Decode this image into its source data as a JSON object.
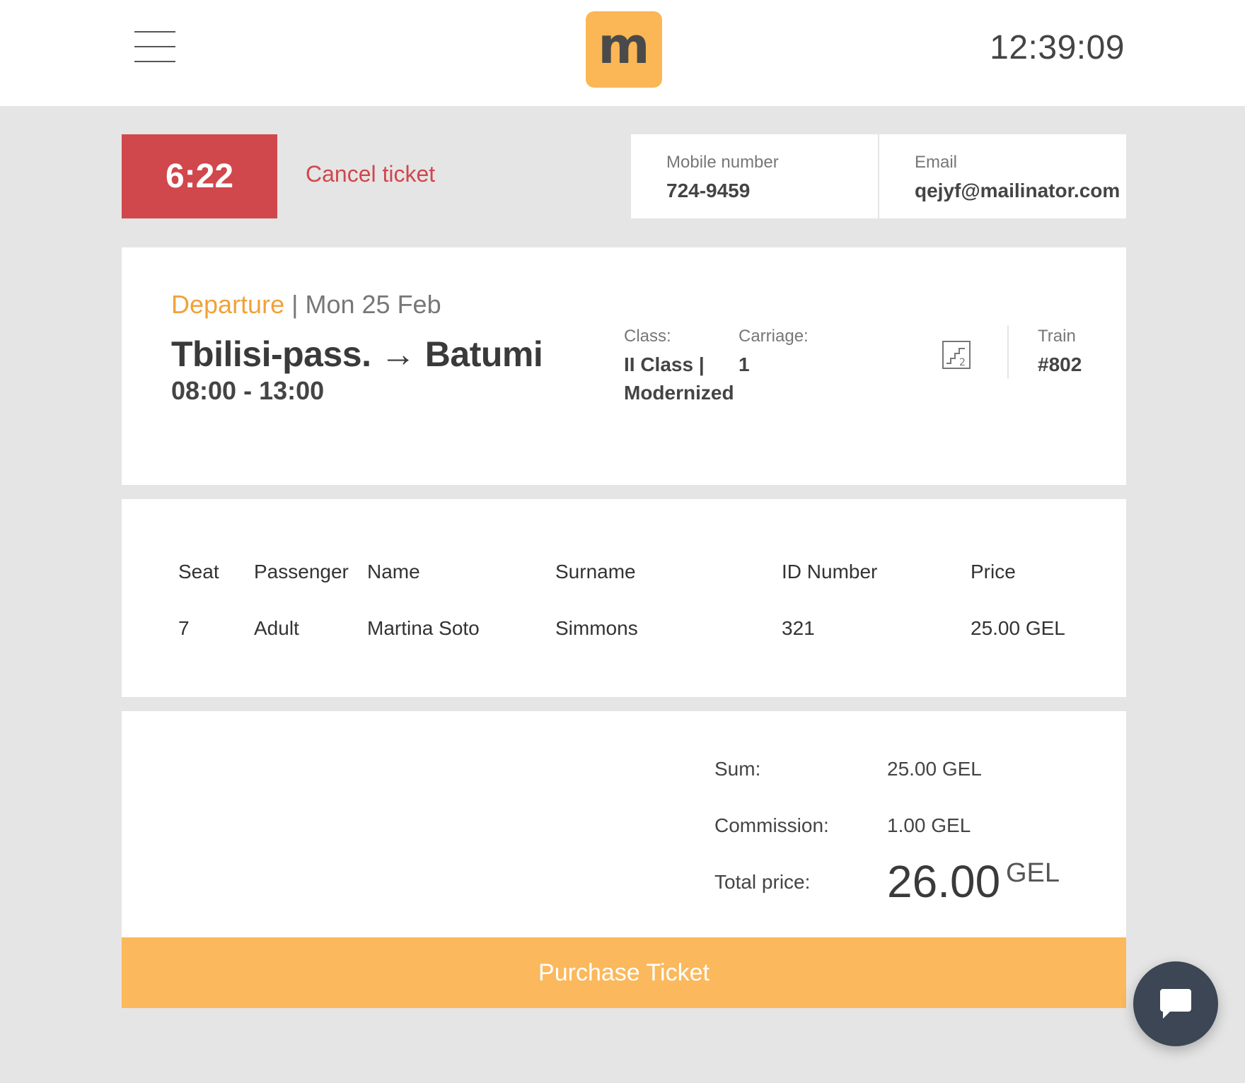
{
  "header": {
    "menu_icon": "hamburger-menu-icon",
    "logo_text": "m",
    "clock": "12:39:09"
  },
  "booking": {
    "timer": "6:22",
    "cancel_label": "Cancel ticket",
    "mobile_label": "Mobile number",
    "mobile_value": "724-9459",
    "email_label": "Email",
    "email_value": "qejyf@mailinator.com"
  },
  "journey": {
    "direction": "Departure",
    "separator": "|",
    "date": "Mon 25 Feb",
    "from": "Tbilisi-pass.",
    "arrow": "→",
    "to": "Batumi",
    "times": "08:00 - 13:00",
    "class_label": "Class:",
    "class_value": "II Class | Modernized",
    "carriage_label": "Carriage:",
    "carriage_value": "1",
    "floor_icon": "stairs-floor-2-icon",
    "train_label": "Train",
    "train_value": "#802"
  },
  "passengers": {
    "columns": [
      "Seat",
      "Passenger",
      "Name",
      "Surname",
      "ID Number",
      "Price"
    ],
    "rows": [
      [
        "7",
        "Adult",
        "Martina Soto",
        "Simmons",
        "321",
        "25.00 GEL"
      ]
    ]
  },
  "summary": {
    "sum_label": "Sum:",
    "sum_value": "25.00 GEL",
    "commission_label": "Commission:",
    "commission_value": "1.00 GEL",
    "total_label": "Total price:",
    "total_value": "26.00",
    "total_currency": "GEL"
  },
  "actions": {
    "purchase_label": "Purchase Ticket",
    "chat_icon": "chat-bubble-icon"
  },
  "colors": {
    "accent_orange": "#fbb85c",
    "logo_orange": "#fbb655",
    "departure_orange": "#f0a23a",
    "timer_red": "#d0474c",
    "chat_dark": "#3c4654",
    "page_background": "#e5e5e5"
  }
}
